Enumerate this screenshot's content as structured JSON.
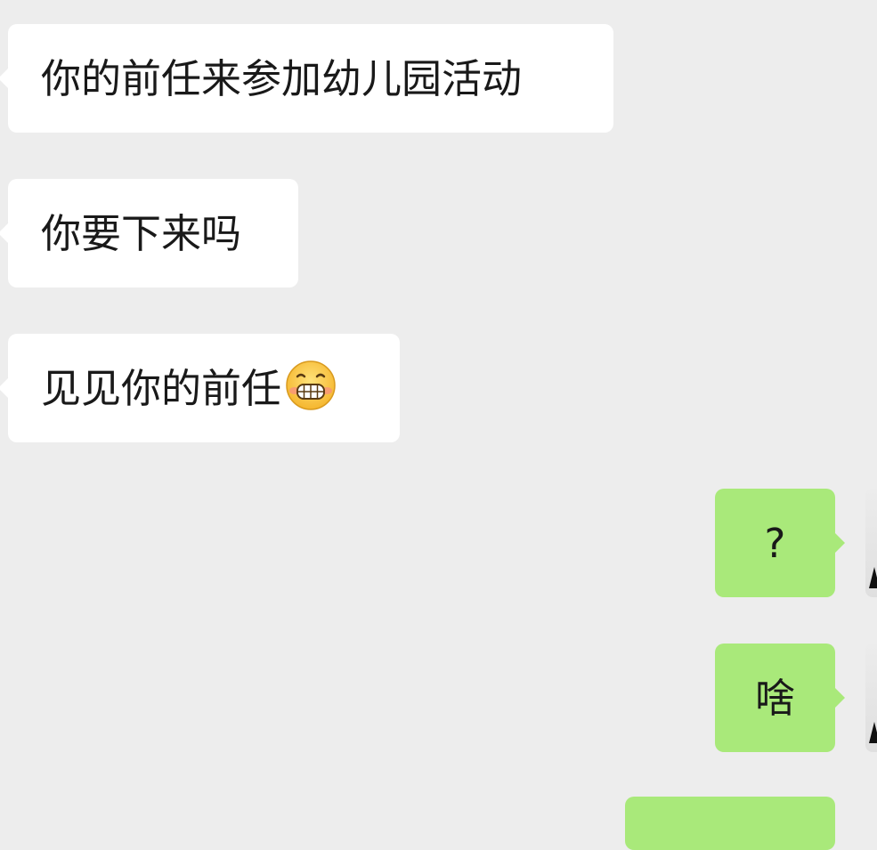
{
  "chat": {
    "messages": [
      {
        "from": "them",
        "text": "你的前任来参加幼儿园活动"
      },
      {
        "from": "them",
        "text": "你要下来吗"
      },
      {
        "from": "them",
        "text": "见见你的前任",
        "emoji": "grinning-face-with-teeth"
      },
      {
        "from": "me",
        "text": "?"
      },
      {
        "from": "me",
        "text": "啥"
      }
    ]
  },
  "colors": {
    "background": "#ededed",
    "incoming_bubble": "#ffffff",
    "outgoing_bubble": "#a9e97a",
    "text": "#191919"
  }
}
